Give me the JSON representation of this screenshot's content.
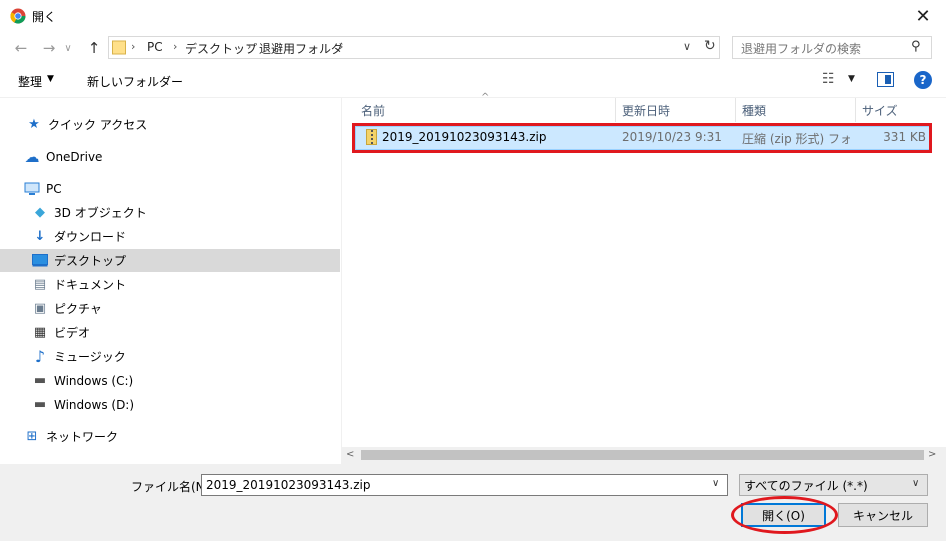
{
  "window": {
    "title": "開く",
    "close_glyph": "✕",
    "app_icon": "chrome-icon"
  },
  "nav": {
    "back_glyph": "←",
    "forward_glyph": "→",
    "recent_glyph": "∨",
    "up_glyph": "↑",
    "breadcrumb": [
      "PC",
      "デスクトップ",
      "退避用フォルダ"
    ],
    "separator": "›",
    "dropdown_glyph": "∨",
    "refresh_glyph": "↻",
    "search_placeholder": "退避用フォルダの検索",
    "search_glyph": "⚲"
  },
  "toolbar": {
    "organize_label": "整理",
    "organize_dd": "▼",
    "new_folder_label": "新しいフォルダー",
    "view_glyph": "☷",
    "view_dd": "▼",
    "help_glyph": "?"
  },
  "sidebar": {
    "items": [
      {
        "label": "クイック アクセス",
        "icon": "star-icon",
        "glyph": "★",
        "color": "#1e6fc9"
      },
      {
        "label": "OneDrive",
        "icon": "cloud-icon",
        "glyph": "☁",
        "color": "#1e6fc9"
      },
      {
        "label": "PC",
        "icon": "computer-icon",
        "glyph": "🖳",
        "color": "#2a7fd4"
      },
      {
        "label": "3D オブジェクト",
        "icon": "cube-icon",
        "glyph": "◆",
        "color": "#3aa6d9"
      },
      {
        "label": "ダウンロード",
        "icon": "download-icon",
        "glyph": "↓",
        "color": "#1e6fc9"
      },
      {
        "label": "デスクトップ",
        "icon": "desktop-icon",
        "glyph": "▭",
        "color": "#1e6fc9"
      },
      {
        "label": "ドキュメント",
        "icon": "document-icon",
        "glyph": "▤",
        "color": "#6b7d8f"
      },
      {
        "label": "ピクチャ",
        "icon": "picture-icon",
        "glyph": "▣",
        "color": "#6b7d8f"
      },
      {
        "label": "ビデオ",
        "icon": "video-icon",
        "glyph": "▦",
        "color": "#333333"
      },
      {
        "label": "ミュージック",
        "icon": "music-icon",
        "glyph": "♪",
        "color": "#1e6fc9"
      },
      {
        "label": "Windows (C:)",
        "icon": "drive-c-icon",
        "glyph": "▬",
        "color": "#555555"
      },
      {
        "label": "Windows (D:)",
        "icon": "drive-d-icon",
        "glyph": "▬",
        "color": "#555555"
      },
      {
        "label": "ネットワーク",
        "icon": "network-icon",
        "glyph": "⊞",
        "color": "#1e6fc9"
      }
    ]
  },
  "columns": {
    "name": "名前",
    "modified": "更新日時",
    "type": "種類",
    "size": "サイズ",
    "sort_glyph": "^"
  },
  "files": [
    {
      "name": "2019_20191023093143.zip",
      "modified": "2019/10/23 9:31",
      "type": "圧縮 (zip 形式) フォ...",
      "size": "331 KB"
    }
  ],
  "scroll": {
    "left_glyph": "<",
    "right_glyph": ">"
  },
  "footer": {
    "filename_label": "ファイル名(N):",
    "filename_value": "2019_20191023093143.zip",
    "dd_glyph": "∨",
    "filter_value": "すべてのファイル (*.*)",
    "open_label": "開く(O)",
    "cancel_label": "キャンセル"
  },
  "colors": {
    "selection_fill": "#cce8ff",
    "annotation_red": "#e0181e",
    "accent_blue": "#0078d7"
  }
}
